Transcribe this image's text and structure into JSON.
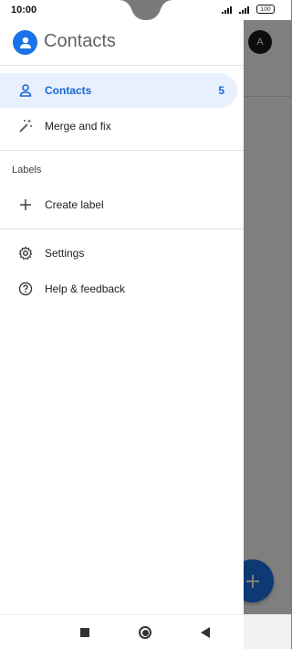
{
  "status_bar": {
    "time": "10:00",
    "battery": "100"
  },
  "background": {
    "avatar_letter": "A"
  },
  "drawer": {
    "title": "Contacts",
    "items": [
      {
        "label": "Contacts",
        "count": "5",
        "icon": "person-icon"
      },
      {
        "label": "Merge and fix",
        "icon": "magic-wand-icon"
      }
    ],
    "labels_heading": "Labels",
    "create_label": "Create label",
    "settings": "Settings",
    "help": "Help & feedback"
  },
  "colors": {
    "accent": "#1a73e8",
    "active_bg": "#e8f0fe",
    "active_text": "#1967d2"
  }
}
